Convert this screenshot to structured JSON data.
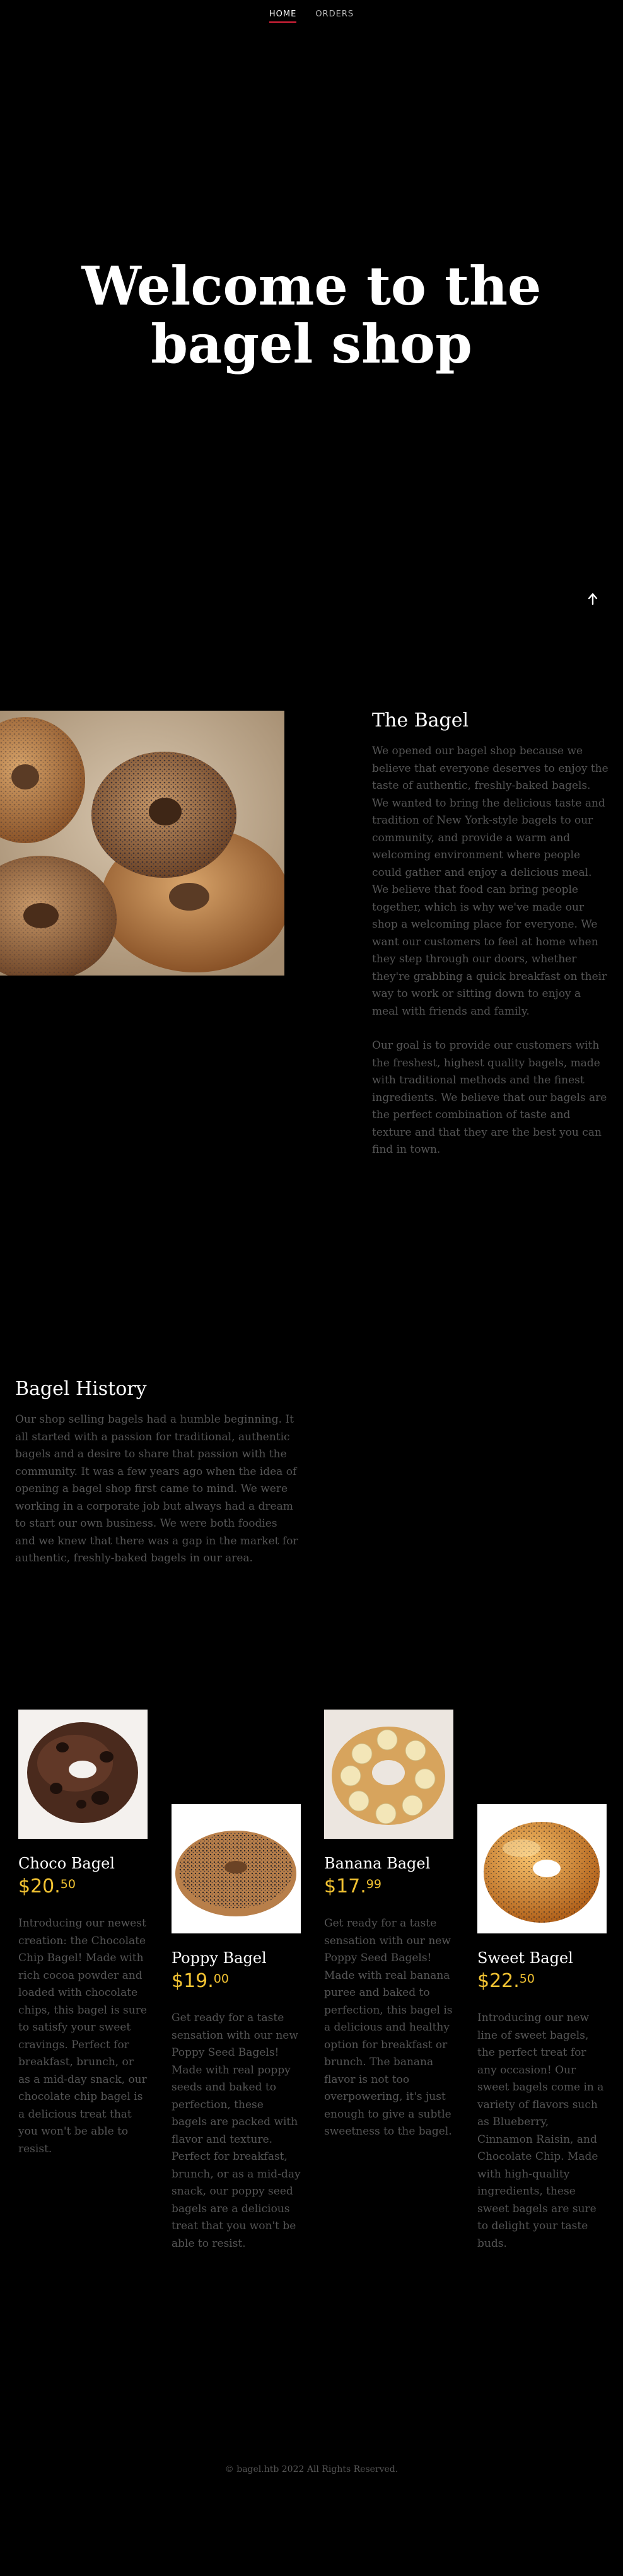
{
  "nav": {
    "items": [
      {
        "label": "HOME",
        "active": true
      },
      {
        "label": "ORDERS",
        "active": false
      }
    ]
  },
  "hero": {
    "title_line1": "Welcome to the",
    "title_line2": "bagel shop"
  },
  "scroll_up": {
    "icon": "arrow-up-icon",
    "glyph": "🡡"
  },
  "about": {
    "title": "The Bagel",
    "paragraph1": "We opened our bagel shop because we believe that everyone deserves to enjoy the taste of authentic, freshly-baked bagels. We wanted to bring the delicious taste and tradition of New York-style bagels to our community, and provide a warm and welcoming environment where people could gather and enjoy a delicious meal. We believe that food can bring people together, which is why we've made our shop a welcoming place for everyone. We want our customers to feel at home when they step through our doors, whether they're grabbing a quick breakfast on their way to work or sitting down to enjoy a meal with friends and family.",
    "paragraph2": "Our goal is to provide our customers with the freshest, highest quality bagels, made with traditional methods and the finest ingredients. We believe that our bagels are the perfect combination of taste and texture and that they are the best you can find in town."
  },
  "history": {
    "title": "Bagel History",
    "text": "Our shop selling bagels had a humble beginning. It all started with a passion for traditional, authentic bagels and a desire to share that passion with the community. It was a few years ago when the idea of opening a bagel shop first came to mind. We were working in a corporate job but always had a dream to start our own business. We were both foodies and we knew that there was a gap in the market for authentic, freshly-baked bagels in our area."
  },
  "products": [
    {
      "name": "Choco Bagel",
      "price_main": "$20.",
      "price_cents": "50",
      "description": "Introducing our newest creation: the Chocolate Chip Bagel! Made with rich cocoa powder and loaded with chocolate chips, this bagel is sure to satisfy your sweet cravings. Perfect for breakfast, brunch, or as a mid-day snack, our chocolate chip bagel is a delicious treat that you won't be able to resist."
    },
    {
      "name": "Poppy Bagel",
      "price_main": "$19.",
      "price_cents": "00",
      "description": "Get ready for a taste sensation with our new Poppy Seed Bagels! Made with real poppy seeds and baked to perfection, these bagels are packed with flavor and texture. Perfect for breakfast, brunch, or as a mid-day snack, our poppy seed bagels are a delicious treat that you won't be able to resist."
    },
    {
      "name": "Banana Bagel",
      "price_main": "$17.",
      "price_cents": "99",
      "description": "Get ready for a taste sensation with our new Poppy Seed Bagels! Made with real banana puree and baked to perfection, this bagel is a delicious and healthy option for breakfast or brunch. The banana flavor is not too overpowering, it's just enough to give a subtle sweetness to the bagel."
    },
    {
      "name": "Sweet Bagel",
      "price_main": "$22.",
      "price_cents": "50",
      "description": "Introducing our new line of sweet bagels, the perfect treat for any occasion! Our sweet bagels come in a variety of flavors such as Blueberry, Cinnamon Raisin, and Chocolate Chip. Made with high-quality ingredients, these sweet bagels are sure to delight your taste buds."
    }
  ],
  "footer": {
    "text": "© bagel.htb 2022 All Rights Reserved."
  },
  "colors": {
    "background": "#000000",
    "accent_underline": "#e0233c",
    "price": "#f1c232",
    "body_text": "#555555"
  }
}
